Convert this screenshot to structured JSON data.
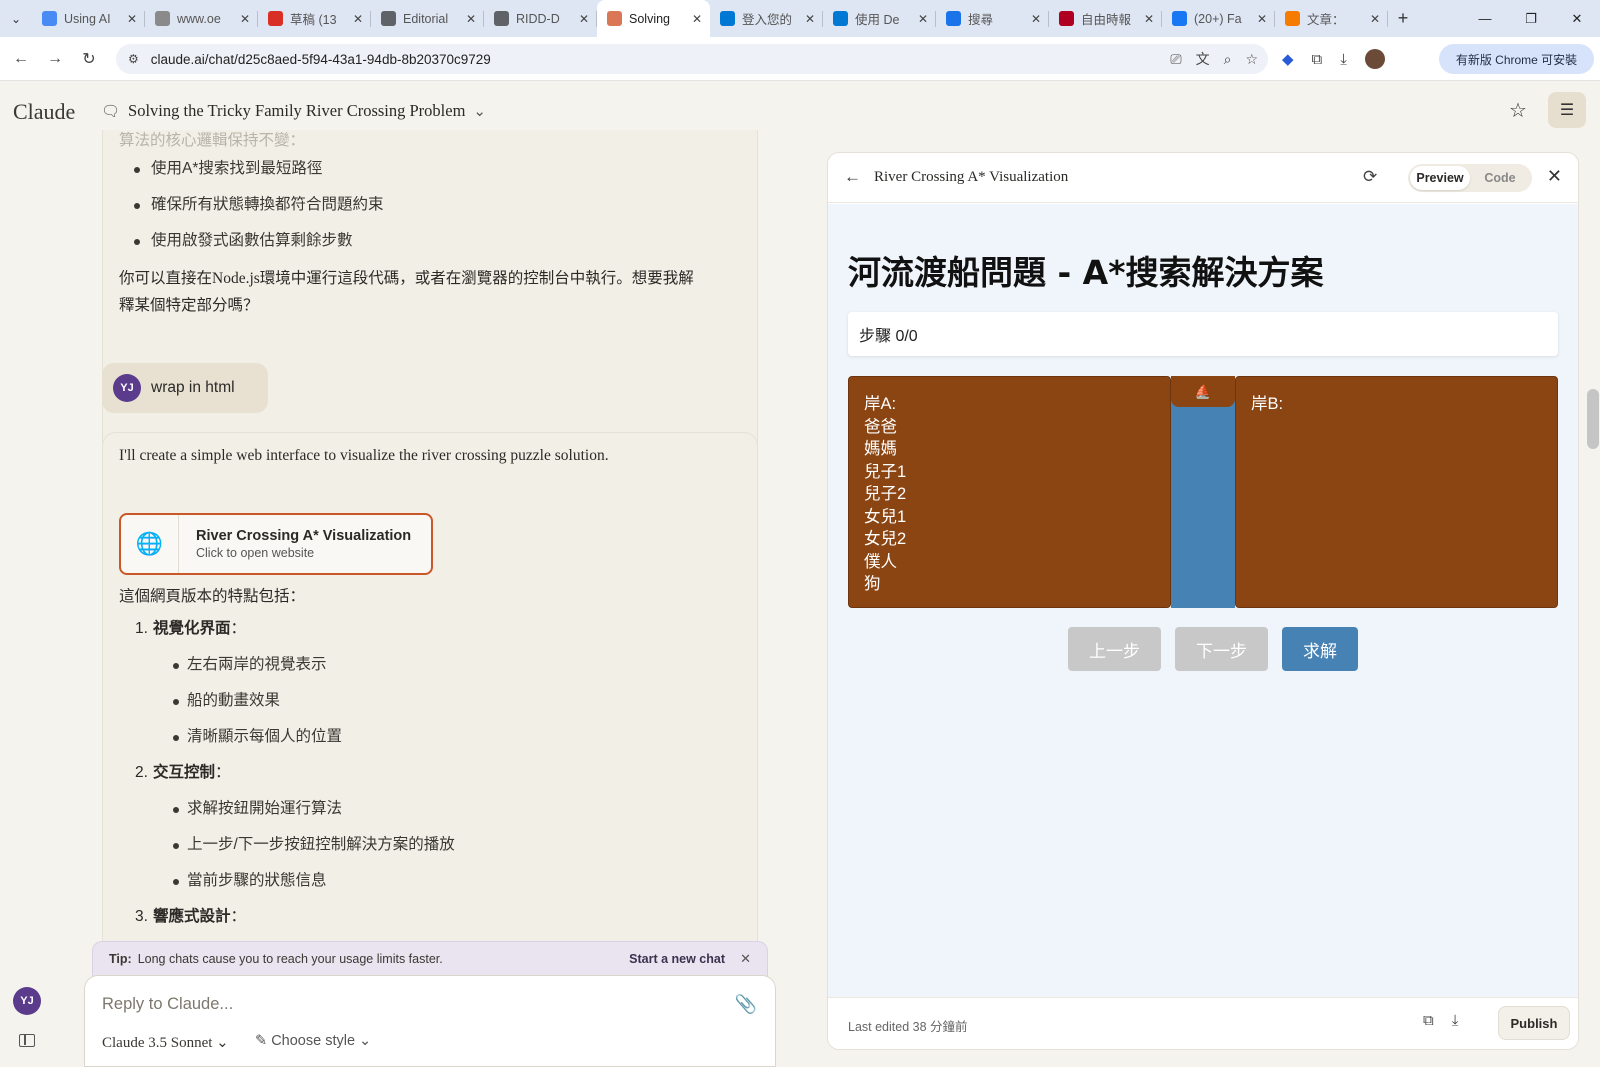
{
  "browser": {
    "tabs": [
      {
        "title": "Using AI",
        "fav_color": "#4a8af4"
      },
      {
        "title": "www.oe",
        "fav_color": "#8a8a8a"
      },
      {
        "title": "草稿 (13",
        "fav_color": "#d93025"
      },
      {
        "title": "Editorial",
        "fav_color": "#5f6368"
      },
      {
        "title": "RIDD-D",
        "fav_color": "#5f6368"
      },
      {
        "title": "Solving",
        "fav_color": "#d97757"
      },
      {
        "title": "登入您的",
        "fav_color": "#0078d4"
      },
      {
        "title": "使用 De",
        "fav_color": "#0078d4"
      },
      {
        "title": "搜尋",
        "fav_color": "#1a73e8"
      },
      {
        "title": "自由時報",
        "fav_color": "#b00020"
      },
      {
        "title": "(20+) Fa",
        "fav_color": "#1877f2"
      },
      {
        "title": "文章：",
        "fav_color": "#f57c00"
      }
    ],
    "active_tab_index": 5,
    "url": "claude.ai/chat/d25c8aed-5f94-43a1-94db-8b20370c9729",
    "update_label": "有新版 Chrome 可安裝"
  },
  "header": {
    "logo": "Claude",
    "chat_title": "Solving the Tricky Family River Crossing Problem"
  },
  "chat": {
    "faded_line": "算法的核心邏輯保持不變：",
    "top_bullets": [
      "使用A*搜索找到最短路徑",
      "確保所有狀態轉換都符合問題約束",
      "使用啟發式函數估算剩餘步數"
    ],
    "top_para": "你可以直接在Node.js環境中運行這段代碼，或者在瀏覽器的控制台中執行。想要我解釋某個特定部分嗎？",
    "user_initials": "YJ",
    "user_message": "wrap in html",
    "reply_intro": "I'll create a simple web interface to visualize the river crossing puzzle solution.",
    "artifact_title": "River Crossing A* Visualization",
    "artifact_sub": "Click to open website",
    "features_intro": "這個網頁版本的特點包括：",
    "features": [
      {
        "num": "1.",
        "title": "視覺化界面",
        "items": [
          "左右兩岸的視覺表示",
          "船的動畫效果",
          "清晰顯示每個人的位置"
        ]
      },
      {
        "num": "2.",
        "title": "交互控制",
        "items": [
          "求解按鈕開始運行算法",
          "上一步/下一步按鈕控制解決方案的播放",
          "當前步驟的狀態信息"
        ]
      },
      {
        "num": "3.",
        "title": "響應式設計",
        "items": []
      }
    ],
    "colon": "："
  },
  "tip": {
    "label": "Tip:",
    "text": "Long chats cause you to reach your usage limits faster.",
    "link": "Start a new chat"
  },
  "composer": {
    "placeholder": "Reply to Claude...",
    "model": "Claude 3.5 Sonnet",
    "style": "Choose style"
  },
  "panel": {
    "title": "River Crossing A* Visualization",
    "toggle": [
      "Preview",
      "Code"
    ],
    "heading": "河流渡船問題 - A*搜索解決方案",
    "step_label": "步驟 0/0",
    "bank_a_label": "岸A:",
    "bank_a_members": [
      "爸爸",
      "媽媽",
      "兒子1",
      "兒子2",
      "女兒1",
      "女兒2",
      "僕人",
      "狗"
    ],
    "bank_b_label": "岸B:",
    "boat_icon": "⛵",
    "prev_label": "上一步",
    "next_label": "下一步",
    "solve_label": "求解",
    "last_edited": "Last edited 38 分鐘前",
    "publish": "Publish"
  },
  "colors": {
    "bank": "#8b4513",
    "river": "#4682b4",
    "accent": "#c9572a"
  }
}
